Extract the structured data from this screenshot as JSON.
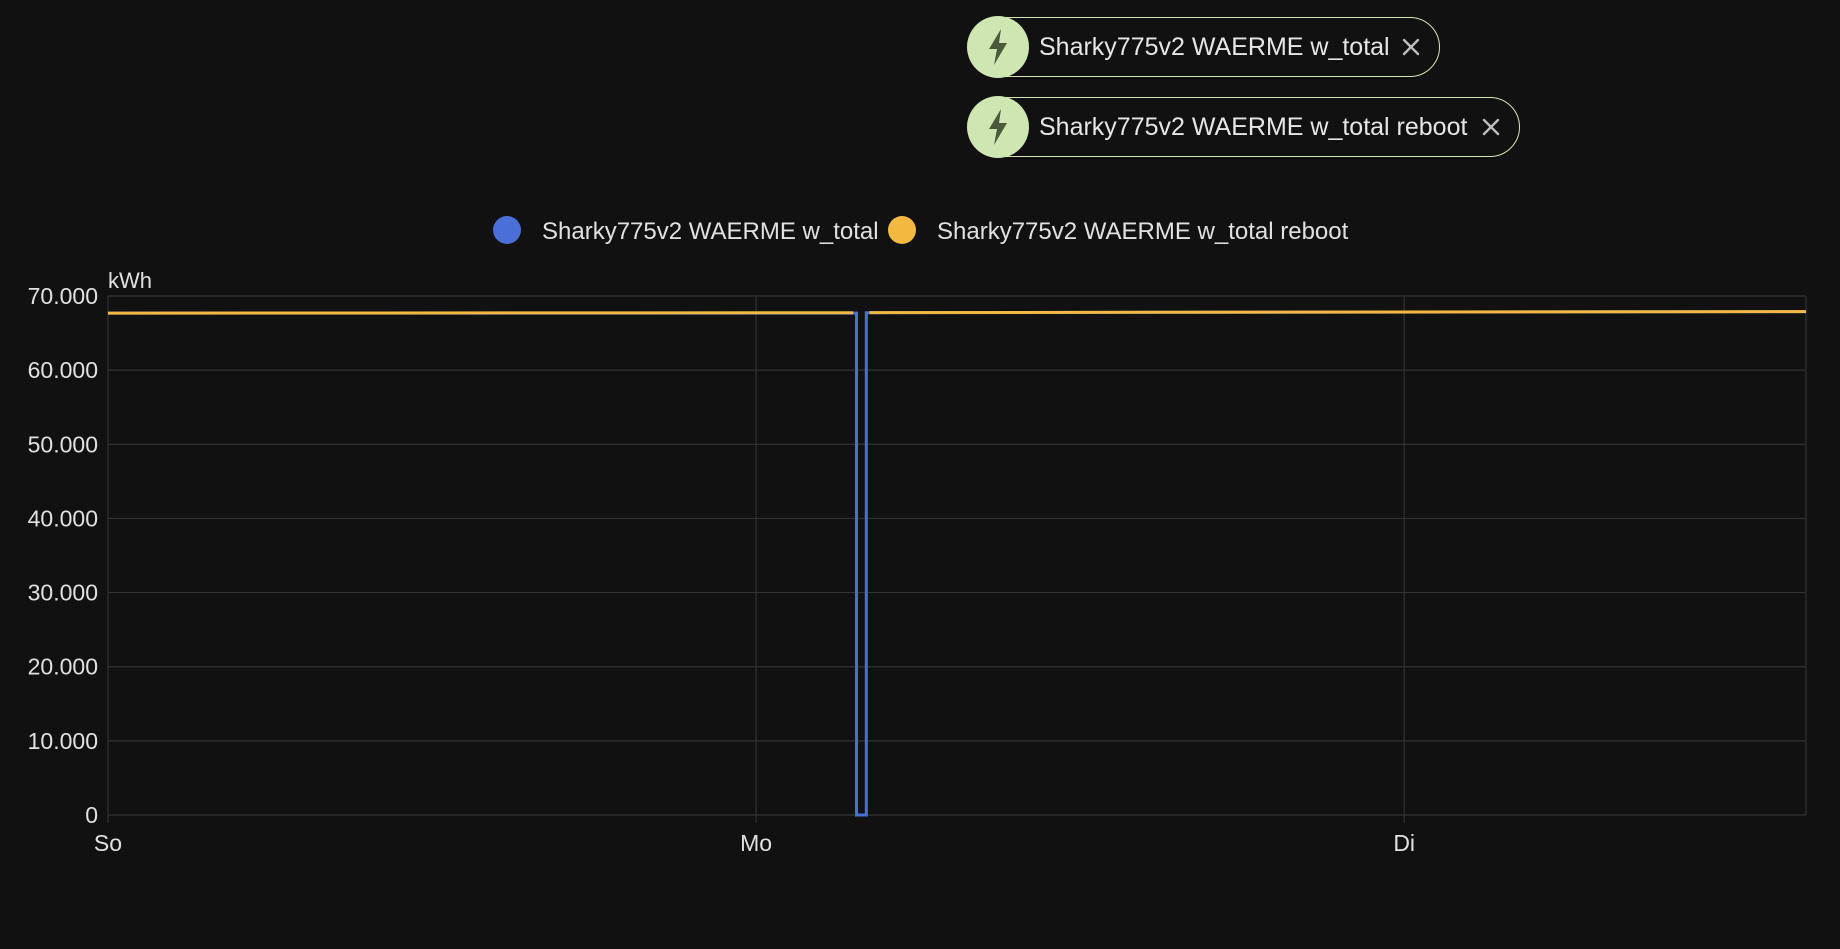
{
  "chips": [
    {
      "label": "Sharky775v2 WAERME w_total",
      "icon": "lightning-bolt-icon",
      "close_icon": "close-icon"
    },
    {
      "label": "Sharky775v2 WAERME w_total reboot",
      "icon": "lightning-bolt-icon",
      "close_icon": "close-icon"
    }
  ],
  "colors": {
    "background": "#111111",
    "chip_border": "#d4e6b5",
    "chip_icon_bg": "#cfe5b2",
    "chip_icon_fg": "#4a5a3a",
    "grid": "#333333",
    "text": "#e1e1e1",
    "series_blue": "#4a6fd6",
    "series_orange": "#f2b83f"
  },
  "chart_data": {
    "type": "line",
    "ylabel": "kWh",
    "ylim": [
      0,
      70000
    ],
    "yticks": [
      0,
      10000,
      20000,
      30000,
      40000,
      50000,
      60000,
      70000
    ],
    "ytick_labels": [
      "0",
      "10.000",
      "20.000",
      "30.000",
      "40.000",
      "50.000",
      "60.000",
      "70.000"
    ],
    "xlim": [
      0,
      2.62
    ],
    "xticks": [
      0,
      1,
      2
    ],
    "xtick_labels": [
      "So",
      "Mo",
      "Di"
    ],
    "grid": true,
    "legend_position": "top-center",
    "series": [
      {
        "name": "Sharky775v2 WAERME w_total",
        "color": "#4a6fd6",
        "step": true,
        "points": [
          [
            0,
            67700
          ],
          [
            1.155,
            67700
          ],
          [
            1.155,
            0
          ],
          [
            1.17,
            0
          ],
          [
            1.17,
            67750
          ],
          [
            2.62,
            67900
          ]
        ]
      },
      {
        "name": "Sharky775v2 WAERME w_total reboot",
        "color": "#f2b83f",
        "step": true,
        "segments": [
          [
            [
              0,
              67700
            ],
            [
              1.15,
              67750
            ]
          ],
          [
            [
              1.175,
              67760
            ],
            [
              2.62,
              67900
            ]
          ]
        ]
      }
    ]
  }
}
